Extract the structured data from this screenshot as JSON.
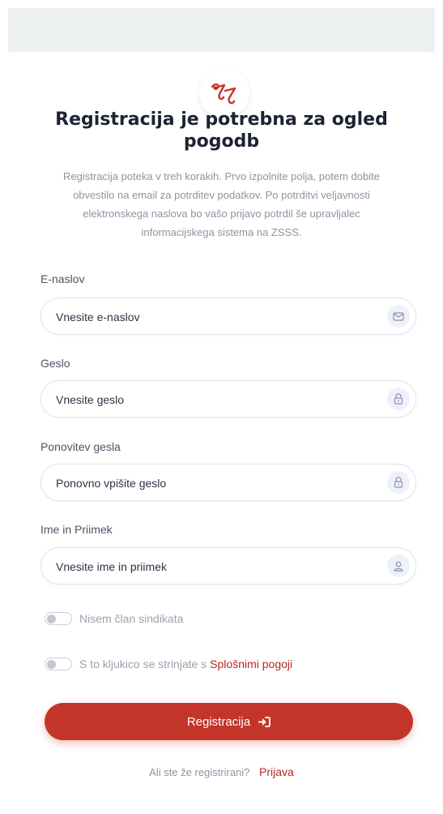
{
  "header": {
    "title": "Registracija je potrebna za ogled pogodb",
    "intro": "Registracija poteka v treh korakih. Prvo izpolnite polja, potem dobite obvestilo na email za potrditev podatkov. Po potrditvi veljavnosti elektronskega naslova bo vašo prijavo potrdil še upravljalec informacijskega sistema na ZSSS."
  },
  "form": {
    "email": {
      "label": "E-naslov",
      "placeholder": "Vnesite e-naslov",
      "value": "",
      "icon": "mail-icon"
    },
    "password": {
      "label": "Geslo",
      "placeholder": "Vnesite geslo",
      "value": "",
      "icon": "lock-icon"
    },
    "password_repeat": {
      "label": "Ponovitev gesla",
      "placeholder": "Ponovno vpišite geslo",
      "value": "",
      "icon": "lock-icon"
    },
    "full_name": {
      "label": "Ime in Priimek",
      "placeholder": "Vnesite ime in priimek",
      "value": "",
      "icon": "user-icon"
    },
    "not_member": {
      "label": "Nisem član sindikata",
      "checked": false
    },
    "terms": {
      "label": "S to kljukico se strinjate s",
      "link": "Splošnimi pogoji",
      "checked": false
    },
    "submit_label": "Registracija"
  },
  "footer": {
    "question": "Ali ste že registrirani?",
    "login_link": "Prijava"
  },
  "colors": {
    "accent": "#c33529",
    "link": "#b32a23",
    "muted_text": "#8c95a3",
    "icon_bg": "#eef0fa"
  }
}
